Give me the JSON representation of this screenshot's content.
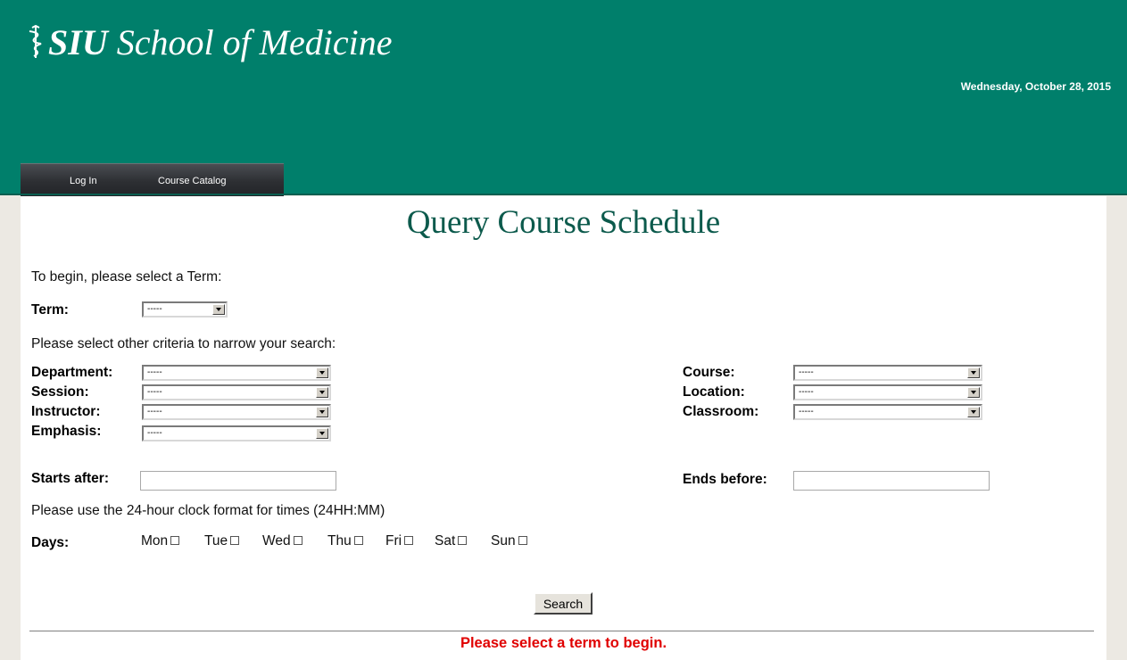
{
  "header": {
    "logo_siu": "SIU",
    "logo_school": "School of Medicine",
    "date": "Wednesday, October 28, 2015",
    "nav": [
      "Log In",
      "Course Catalog"
    ],
    "color": "#007f6b"
  },
  "page": {
    "title": "Query Course Schedule",
    "intro": "To begin, please select a Term:",
    "narrow": "Please select other criteria to narrow your search:",
    "time_note": "Please use the 24-hour clock format for times (24HH:MM)",
    "search": "Search",
    "status": "Please select a term to begin."
  },
  "fields": {
    "term": {
      "label": "Term:",
      "value": "-----"
    },
    "department": {
      "label": "Department:",
      "value": "-----"
    },
    "session": {
      "label": "Session:",
      "value": "-----"
    },
    "instructor": {
      "label": "Instructor:",
      "value": "-----"
    },
    "emphasis": {
      "label": "Emphasis:",
      "value": "-----"
    },
    "course": {
      "label": "Course:",
      "value": "-----"
    },
    "location": {
      "label": "Location:",
      "value": "-----"
    },
    "classroom": {
      "label": "Classroom:",
      "value": "-----"
    },
    "starts_after": {
      "label": "Starts after:",
      "value": ""
    },
    "ends_before": {
      "label": "Ends before:",
      "value": ""
    },
    "days": {
      "label": "Days:"
    }
  },
  "days": [
    "Mon",
    "Tue",
    "Wed",
    "Thu",
    "Fri",
    "Sat",
    "Sun"
  ]
}
